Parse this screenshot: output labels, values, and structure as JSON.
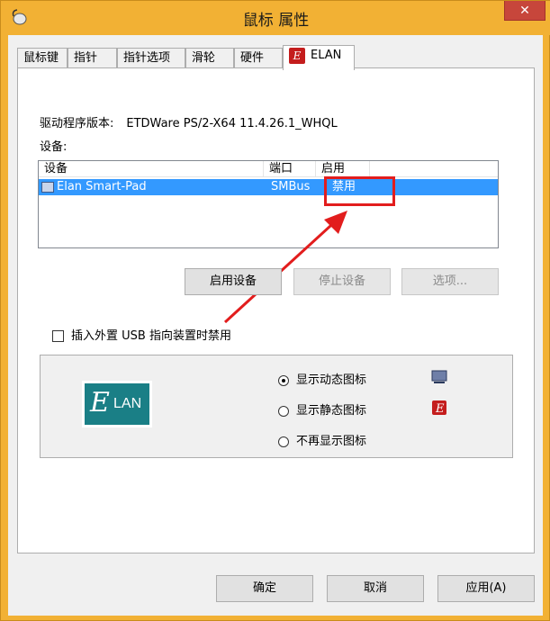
{
  "window": {
    "title": "鼠标 属性",
    "close_glyph": "✕"
  },
  "tabs": [
    "鼠标键",
    "指针",
    "指针选项",
    "滑轮",
    "硬件",
    "ELAN"
  ],
  "elan_tab_icon": "E",
  "driver": {
    "label": "驱动程序版本:",
    "value": "ETDWare PS/2-X64 11.4.26.1_WHQL"
  },
  "devices_label": "设备:",
  "device_list": {
    "columns": [
      "设备",
      "端口",
      "启用"
    ],
    "rows": [
      {
        "device": "Elan Smart-Pad",
        "port": "SMBus",
        "enabled": "禁用"
      }
    ]
  },
  "buttons": {
    "enable": "启用设备",
    "stop": "停止设备",
    "options": "选项..."
  },
  "checkbox": {
    "label": "插入外置 USB 指向装置时禁用",
    "checked": false
  },
  "logo_text": "LAN",
  "logo_letter": "E",
  "radio_options": [
    {
      "label": "显示动态图标",
      "checked": true,
      "icon": "monitor-icon"
    },
    {
      "label": "显示静态图标",
      "checked": false,
      "icon": "elan-red-icon"
    },
    {
      "label": "不再显示图标",
      "checked": false,
      "icon": ""
    }
  ],
  "footer": {
    "ok": "确定",
    "cancel": "取消",
    "apply": "应用(A)"
  },
  "colors": {
    "title_bar": "#f2b134",
    "selection": "#3399ff",
    "highlight": "#e21d1d"
  }
}
